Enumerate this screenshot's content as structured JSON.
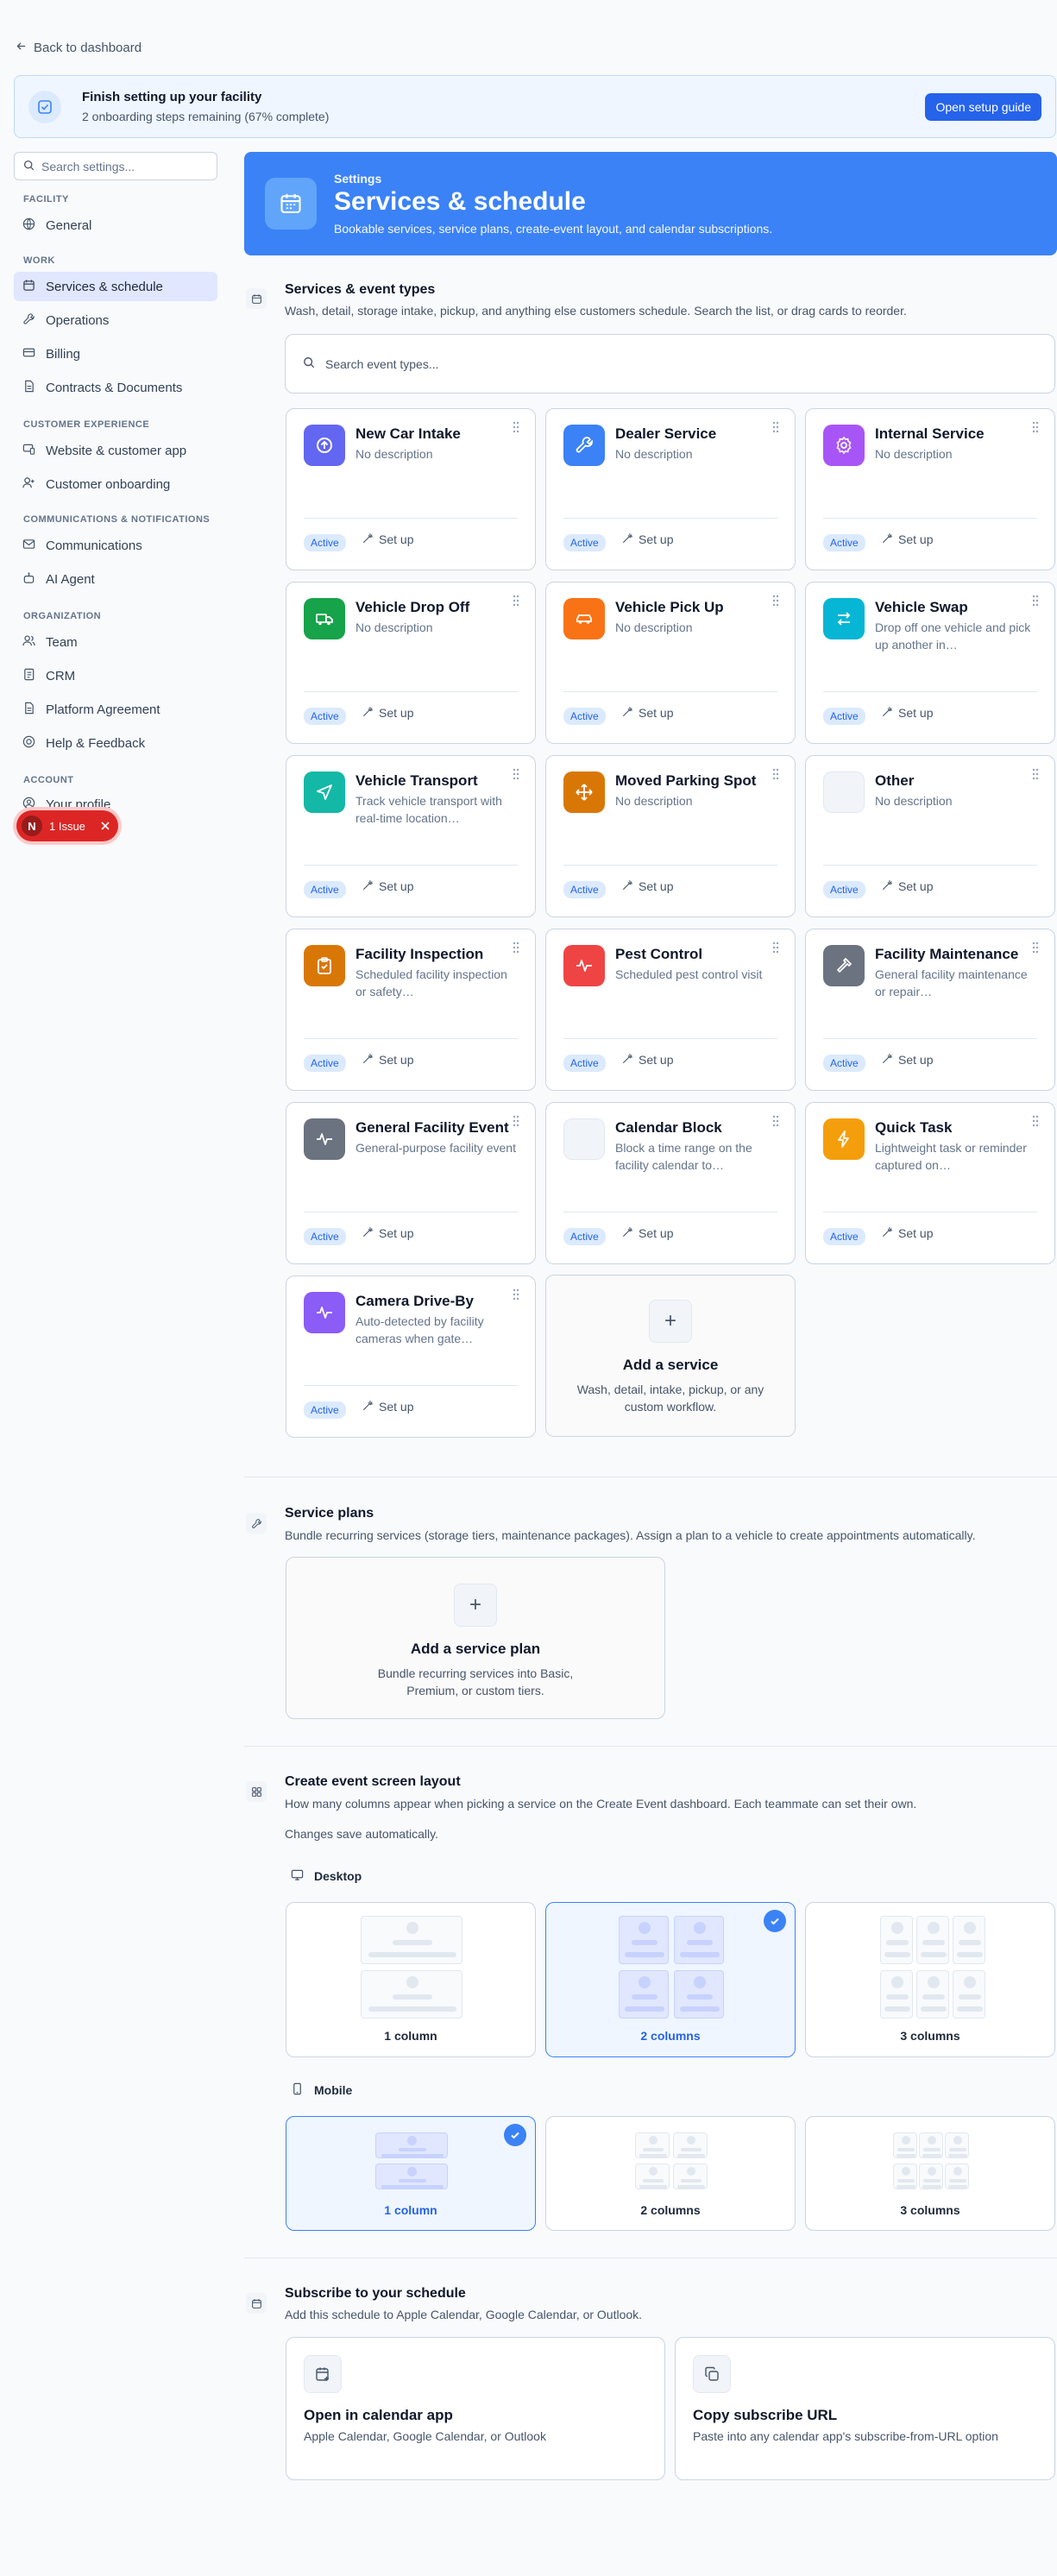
{
  "nav_back": "Back to dashboard",
  "banner": {
    "title": "Finish setting up your facility",
    "subtitle": "2 onboarding steps remaining (67% complete)",
    "button": "Open setup guide"
  },
  "sidebar": {
    "search_placeholder": "Search settings...",
    "sections": {
      "facility": "FACILITY",
      "work": "WORK",
      "customer": "CUSTOMER EXPERIENCE",
      "comms": "COMMUNICATIONS & NOTIFICATIONS",
      "org": "ORGANIZATION",
      "account": "ACCOUNT"
    },
    "items": [
      {
        "label": "General",
        "icon": "globe-icon"
      },
      {
        "label": "Services & schedule",
        "icon": "calendar-icon"
      },
      {
        "label": "Operations",
        "icon": "wrench-icon"
      },
      {
        "label": "Billing",
        "icon": "credit-card-icon"
      },
      {
        "label": "Contracts & Documents",
        "icon": "document-icon"
      },
      {
        "label": "Website & customer app",
        "icon": "monitor-icon"
      },
      {
        "label": "Customer onboarding",
        "icon": "user-plus-icon"
      },
      {
        "label": "Communications",
        "icon": "mail-icon"
      },
      {
        "label": "AI Agent",
        "icon": "bot-icon"
      },
      {
        "label": "Team",
        "icon": "users-icon"
      },
      {
        "label": "CRM",
        "icon": "address-book-icon"
      },
      {
        "label": "Platform Agreement",
        "icon": "document-icon"
      },
      {
        "label": "Help & Feedback",
        "icon": "lifebuoy-icon"
      },
      {
        "label": "Your profile",
        "icon": "user-circle-icon"
      }
    ]
  },
  "issue_pill": {
    "avatar": "N",
    "label": "1 Issue"
  },
  "hero": {
    "kicker": "Settings",
    "title": "Services & schedule",
    "subtitle": "Bookable services, service plans, create-event layout, and calendar subscriptions."
  },
  "event_types": {
    "title": "Services & event types",
    "description": "Wash, detail, storage intake, pickup, and anything else customers schedule. Search the list, or drag cards to reorder.",
    "search_placeholder": "Search event types...",
    "status_label": "Active",
    "setup_label": "Set up",
    "cards": [
      {
        "name": "New Car Intake",
        "desc": "No description",
        "icon": "arrow-up-circle-icon",
        "color": "#6366f1"
      },
      {
        "name": "Dealer Service",
        "desc": "No description",
        "icon": "wrench-icon",
        "color": "#3b82f6"
      },
      {
        "name": "Internal Service",
        "desc": "No description",
        "icon": "gear-icon",
        "color": "#a855f7"
      },
      {
        "name": "Vehicle Drop Off",
        "desc": "No description",
        "icon": "truck-icon",
        "color": "#16a34a"
      },
      {
        "name": "Vehicle Pick Up",
        "desc": "No description",
        "icon": "car-icon",
        "color": "#f97316"
      },
      {
        "name": "Vehicle Swap",
        "desc": "Drop off one vehicle and pick up another in…",
        "icon": "swap-icon",
        "color": "#06b6d4"
      },
      {
        "name": "Vehicle Transport",
        "desc": "Track vehicle transport with real-time location…",
        "icon": "navigation-icon",
        "color": "#14b8a6"
      },
      {
        "name": "Moved Parking Spot",
        "desc": "No description",
        "icon": "move-icon",
        "color": "#d97706"
      },
      {
        "name": "Other",
        "desc": "No description",
        "icon": "blank-icon",
        "color": "#f1f5f9"
      },
      {
        "name": "Facility Inspection",
        "desc": "Scheduled facility inspection or safety…",
        "icon": "clipboard-check-icon",
        "color": "#d97706"
      },
      {
        "name": "Pest Control",
        "desc": "Scheduled pest control visit",
        "icon": "activity-icon",
        "color": "#ef4444"
      },
      {
        "name": "Facility Maintenance",
        "desc": "General facility maintenance or repair…",
        "icon": "hammer-icon",
        "color": "#6b7280"
      },
      {
        "name": "General Facility Event",
        "desc": "General-purpose facility event",
        "icon": "activity-icon",
        "color": "#6b7280"
      },
      {
        "name": "Calendar Block",
        "desc": "Block a time range on the facility calendar to…",
        "icon": "blank-icon",
        "color": "#f1f5f9"
      },
      {
        "name": "Quick Task",
        "desc": "Lightweight task or reminder captured on…",
        "icon": "bolt-icon",
        "color": "#f59e0b"
      },
      {
        "name": "Camera Drive-By",
        "desc": "Auto-detected by facility cameras when gate…",
        "icon": "activity-icon",
        "color": "#8b5cf6"
      }
    ],
    "add_title": "Add a service",
    "add_desc": "Wash, detail, intake, pickup, or any custom workflow."
  },
  "service_plans": {
    "title": "Service plans",
    "description": "Bundle recurring services (storage tiers, maintenance packages). Assign a plan to a vehicle to create appointments automatically.",
    "add_title": "Add a service plan",
    "add_desc": "Bundle recurring services into Basic, Premium, or custom tiers."
  },
  "layout": {
    "title": "Create event screen layout",
    "description": "How many columns appear when picking a service on the Create Event dashboard. Each teammate can set their own.",
    "note": "Changes save automatically.",
    "desktop_label": "Desktop",
    "mobile_label": "Mobile",
    "options": [
      "1 column",
      "2 columns",
      "3 columns"
    ],
    "desktop_selected": "2 columns",
    "mobile_selected": "1 column"
  },
  "subscribe": {
    "title": "Subscribe to your schedule",
    "description": "Add this schedule to Apple Calendar, Google Calendar, or Outlook.",
    "open_title": "Open in calendar app",
    "open_desc": "Apple Calendar, Google Calendar, or Outlook",
    "copy_title": "Copy subscribe URL",
    "copy_desc": "Paste into any calendar app's subscribe-from-URL option"
  }
}
